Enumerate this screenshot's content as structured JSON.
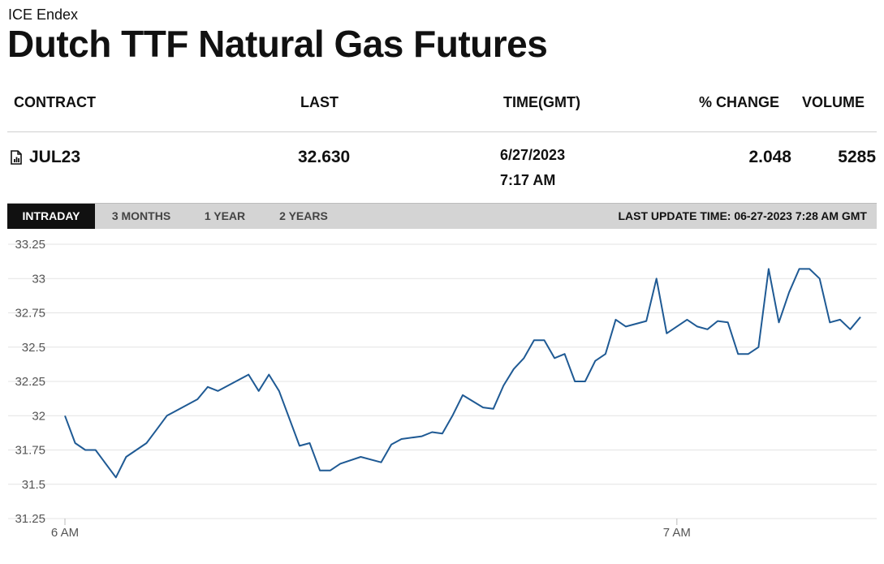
{
  "exchange": "ICE Endex",
  "title": "Dutch TTF Natural Gas Futures",
  "table": {
    "headers": {
      "contract": "CONTRACT",
      "last": "LAST",
      "time": "TIME(GMT)",
      "change": "% CHANGE",
      "volume": "VOLUME"
    },
    "row": {
      "icon": "document-chart-icon",
      "contract": "JUL23",
      "last": "32.630",
      "date": "6/27/2023",
      "time": "7:17 AM",
      "change": "2.048",
      "volume": "5285"
    }
  },
  "tabs": [
    {
      "label": "INTRADAY",
      "active": true
    },
    {
      "label": "3 MONTHS",
      "active": false
    },
    {
      "label": "1 YEAR",
      "active": false
    },
    {
      "label": "2 YEARS",
      "active": false
    }
  ],
  "last_update": "LAST UPDATE TIME: 06-27-2023 7:28 AM GMT",
  "colors": {
    "line": "#1f5a94",
    "grid": "#e3e3e3",
    "tab_active_bg": "#111111",
    "tab_bar_bg": "#d4d4d4"
  },
  "chart_data": {
    "type": "line",
    "title": "",
    "xlabel": "",
    "ylabel": "",
    "ylim": [
      31.25,
      33.25
    ],
    "yticks": [
      31.25,
      31.5,
      31.75,
      32,
      32.25,
      32.5,
      32.75,
      33,
      33.25
    ],
    "ytick_labels": [
      "31.25",
      "31.5",
      "31.75",
      "32",
      "32.25",
      "32.5",
      "32.75",
      "33",
      "33.25"
    ],
    "xlim_minutes": [
      0,
      78
    ],
    "xticks": [
      {
        "minute": 0,
        "label": "6 AM"
      },
      {
        "minute": 60,
        "label": "7 AM"
      }
    ],
    "grid": true,
    "legend": "none",
    "series": [
      {
        "values": [
          [
            0.0,
            32.0
          ],
          [
            1.0,
            31.8
          ],
          [
            2.0,
            31.75
          ],
          [
            3.0,
            31.75
          ],
          [
            5.0,
            31.55
          ],
          [
            6.0,
            31.7
          ],
          [
            8.0,
            31.8
          ],
          [
            9.0,
            31.9
          ],
          [
            10.0,
            32.0
          ],
          [
            13.0,
            32.12
          ],
          [
            14.0,
            32.21
          ],
          [
            15.0,
            32.18
          ],
          [
            18.0,
            32.3
          ],
          [
            19.0,
            32.18
          ],
          [
            20.0,
            32.3
          ],
          [
            21.0,
            32.18
          ],
          [
            23.0,
            31.78
          ],
          [
            24.0,
            31.8
          ],
          [
            25.0,
            31.6
          ],
          [
            26.0,
            31.6
          ],
          [
            27.0,
            31.65
          ],
          [
            29.0,
            31.7
          ],
          [
            31.0,
            31.66
          ],
          [
            32.0,
            31.79
          ],
          [
            33.0,
            31.83
          ],
          [
            35.0,
            31.85
          ],
          [
            36.0,
            31.88
          ],
          [
            37.0,
            31.87
          ],
          [
            38.0,
            32.0
          ],
          [
            39.0,
            32.15
          ],
          [
            41.0,
            32.06
          ],
          [
            42.0,
            32.05
          ],
          [
            43.0,
            32.22
          ],
          [
            44.0,
            32.34
          ],
          [
            45.0,
            32.42
          ],
          [
            46.0,
            32.55
          ],
          [
            47.0,
            32.55
          ],
          [
            48.0,
            32.42
          ],
          [
            49.0,
            32.45
          ],
          [
            50.0,
            32.25
          ],
          [
            51.0,
            32.25
          ],
          [
            52.0,
            32.4
          ],
          [
            53.0,
            32.45
          ],
          [
            54.0,
            32.7
          ],
          [
            55.0,
            32.65
          ],
          [
            57.0,
            32.69
          ],
          [
            58.0,
            33.0
          ],
          [
            59.0,
            32.6
          ],
          [
            61.0,
            32.7
          ],
          [
            62.0,
            32.65
          ],
          [
            63.0,
            32.63
          ],
          [
            64.0,
            32.69
          ],
          [
            65.0,
            32.68
          ],
          [
            66.0,
            32.45
          ],
          [
            67.0,
            32.45
          ],
          [
            68.0,
            32.5
          ],
          [
            69.0,
            33.07
          ],
          [
            70.0,
            32.68
          ],
          [
            71.0,
            32.9
          ],
          [
            72.0,
            33.07
          ],
          [
            73.0,
            33.07
          ],
          [
            74.0,
            33.0
          ],
          [
            75.0,
            32.68
          ],
          [
            76.0,
            32.7
          ],
          [
            77.0,
            32.63
          ],
          [
            78.0,
            32.72
          ]
        ]
      }
    ]
  }
}
